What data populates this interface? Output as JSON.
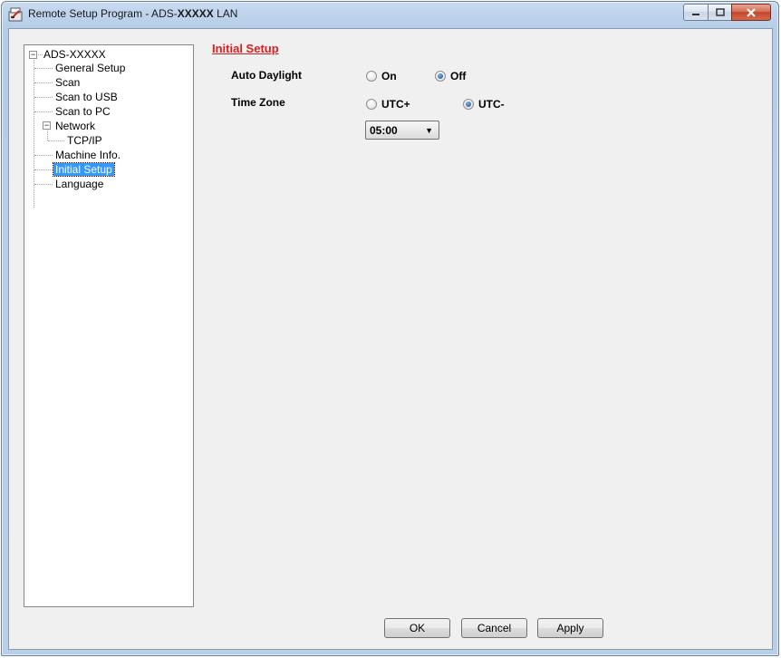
{
  "window": {
    "title_prefix": "Remote Setup Program - ADS-",
    "title_bold": "XXXXX",
    "title_suffix": " LAN"
  },
  "tree": {
    "root": "ADS-XXXXX",
    "items": [
      {
        "label": "General Setup"
      },
      {
        "label": "Scan"
      },
      {
        "label": "Scan to USB"
      },
      {
        "label": "Scan to PC"
      },
      {
        "label": "Network"
      },
      {
        "label": "TCP/IP"
      },
      {
        "label": "Machine Info."
      },
      {
        "label": "Initial Setup",
        "selected": true
      },
      {
        "label": "Language"
      }
    ]
  },
  "panel": {
    "title": "Initial Setup",
    "auto_daylight": {
      "label": "Auto Daylight",
      "option_on": "On",
      "option_off": "Off",
      "selected": "Off"
    },
    "time_zone": {
      "label": "Time Zone",
      "option_plus": "UTC+",
      "option_minus": "UTC-",
      "selected": "UTC-",
      "offset_value": "05:00"
    }
  },
  "buttons": {
    "ok": "OK",
    "cancel": "Cancel",
    "apply": "Apply"
  },
  "colors": {
    "section_title": "#d42020",
    "selection": "#3399ff"
  }
}
